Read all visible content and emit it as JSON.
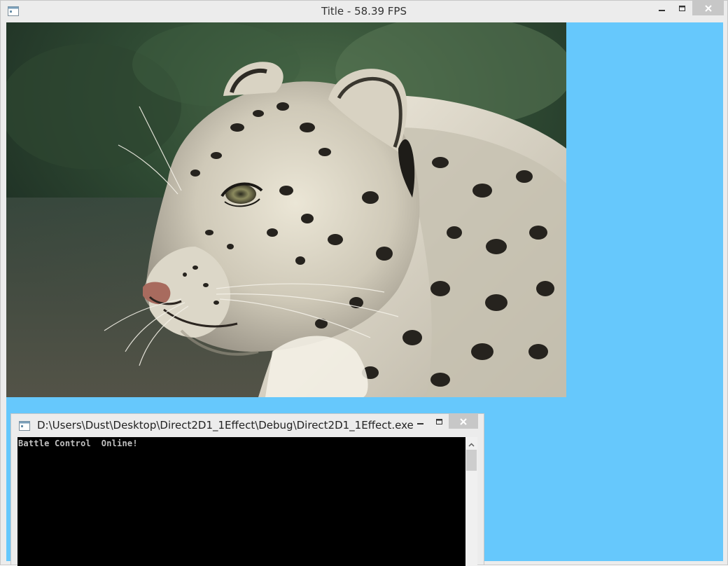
{
  "main_window": {
    "title": "Title - 58.39 FPS",
    "client_background": "#66c8fc"
  },
  "image": {
    "subject": "snow leopard"
  },
  "console": {
    "title": "D:\\Users\\Dust\\Desktop\\Direct2D1_1Effect\\Debug\\Direct2D1_1Effect.exe",
    "output": "Battle Control  Online!",
    "background": "#000000",
    "text_color": "#c0c0c0"
  },
  "icons": {
    "app": "window-app-icon",
    "minimize": "minimize-icon",
    "maximize": "maximize-icon",
    "close": "close-icon",
    "scroll_up": "chevron-up-icon"
  }
}
